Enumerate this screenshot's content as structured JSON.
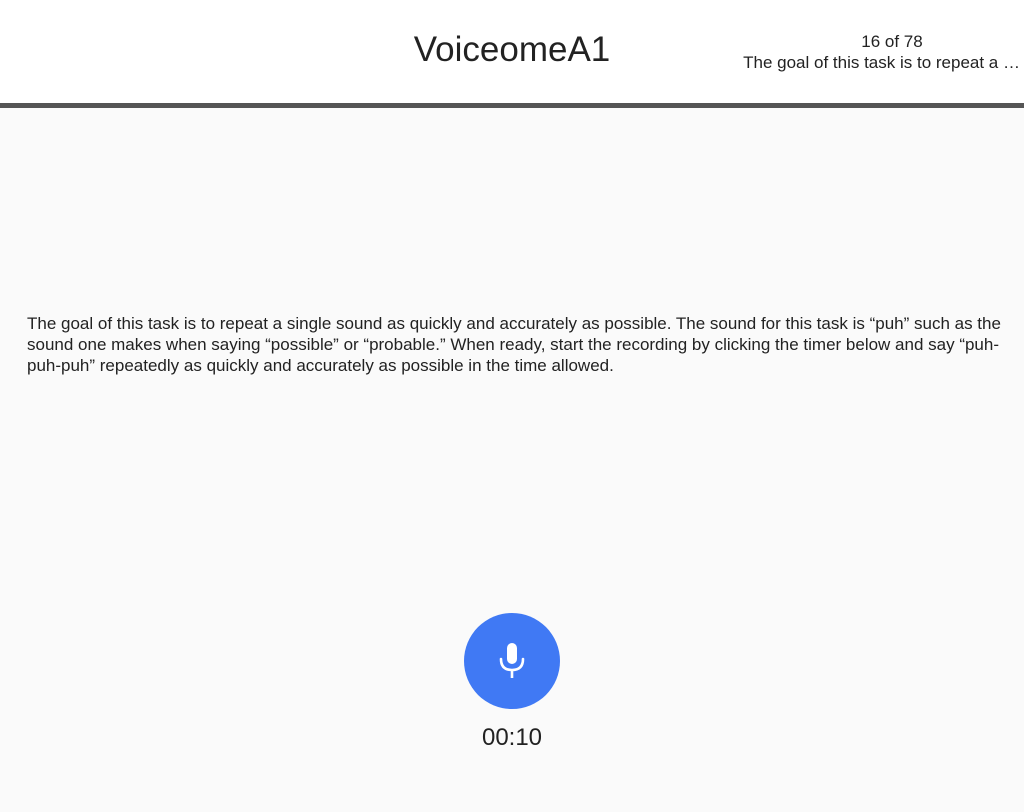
{
  "header": {
    "title": "VoiceomeA1",
    "progress": "16 of 78",
    "subtitle": "The goal of this task is to repeat a …"
  },
  "main": {
    "instructions": "The goal of this task is to repeat a single sound as quickly and accurately as possible. The sound for this task is “puh” such as the sound one makes when saying “possible” or “probable.” When ready, start the recording by clicking the timer below and say “puh-puh-puh” repeatedly as quickly and accurately as possible in the time allowed."
  },
  "recorder": {
    "icon": "microphone-icon",
    "timer": "00:10",
    "accent_color": "#4079f4"
  }
}
